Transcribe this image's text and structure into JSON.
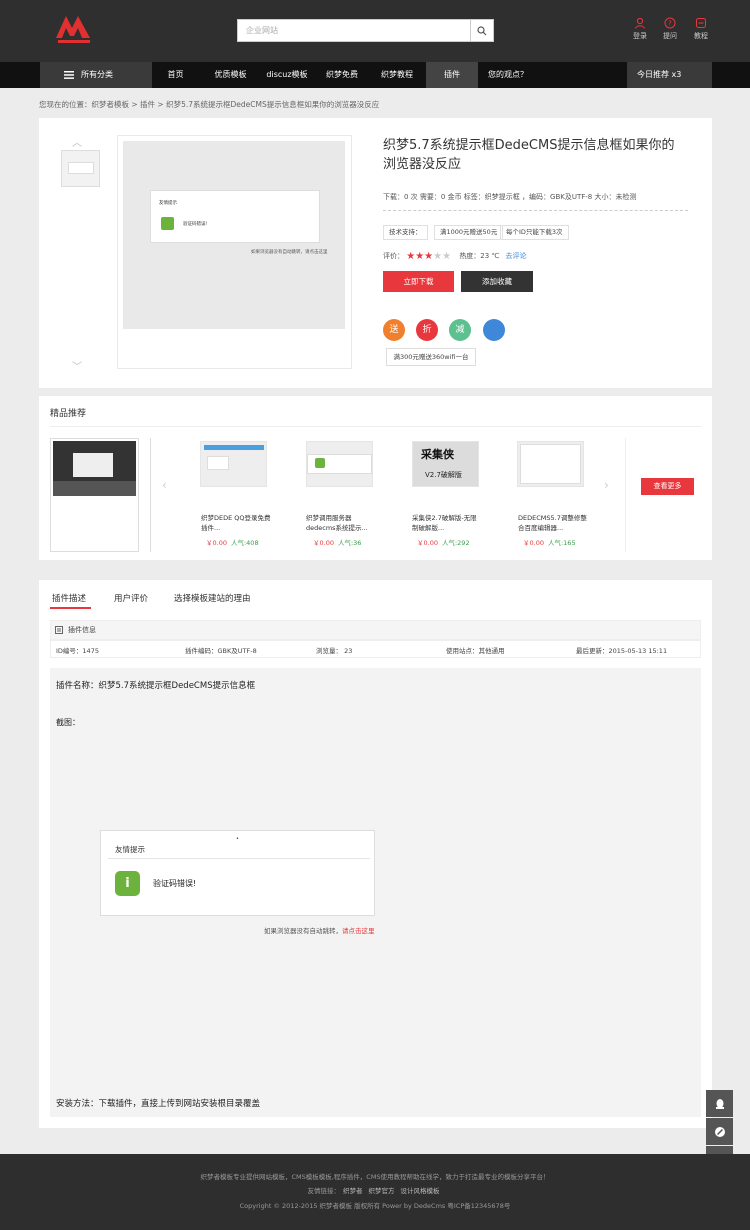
{
  "header": {
    "search_placeholder": "企业网站",
    "icons": [
      {
        "name": "user-icon",
        "label": "登录"
      },
      {
        "name": "help-icon",
        "label": "提问"
      },
      {
        "name": "tutorial-icon",
        "label": "教程"
      }
    ]
  },
  "nav": {
    "category": "所有分类",
    "items": [
      "首页",
      "优质模板",
      "discuz模板",
      "织梦免费",
      "织梦教程",
      "插件",
      "您的观点？"
    ],
    "right": "今日推荐  x3"
  },
  "breadcrumb": "您现在的位置：织梦者模板 > 插件 > 织梦5.7系统提示框DedeCMS提示信息框如果你的浏览器没反应",
  "product": {
    "title": "织梦5.7系统提示框DedeCMS提示信息框如果你的浏览器没反应",
    "meta": "下载：0 次  需要：0 金币  标签：织梦提示框 ，编码：GBK及UTF-8  大小：未检测",
    "tags": [
      "技术支持：",
      "满1000元赠送50元",
      "每个ID只能下载3次"
    ],
    "rating_label": "评价：",
    "heat": "热度：23 ℃",
    "comment_link": "去评论",
    "stars": 3,
    "download_button": "立即下载",
    "favorite_button": "添加收藏",
    "circles": [
      {
        "text": "送",
        "color": "#f0802d"
      },
      {
        "text": "折",
        "color": "#e8383d"
      },
      {
        "text": "减",
        "color": "#5cc08f"
      },
      {
        "text": "",
        "color": "#3f87d9"
      }
    ],
    "promo": "满300元赠送360wifi一台",
    "mock_dialog_title": "友情提示",
    "mock_dialog_msg": "验证码错误!",
    "mock_redirect": "如果浏览器没有自动跳转，请点击这里"
  },
  "recommend": {
    "title": "精品推荐",
    "more_button": "查看更多",
    "items": [
      {
        "name": "织梦DEDE QQ登录免费插件...",
        "price": "￥0.00",
        "pop": "人气:408"
      },
      {
        "name": "织梦调用服务器dedecms系统提示...",
        "price": "￥0.00",
        "pop": "人气:36"
      },
      {
        "name": "采集侠2.7破解版-无限制破解版...",
        "price": "￥0.00",
        "pop": "人气:292",
        "img_title": "采集侠",
        "img_sub": "V2.7破解版"
      },
      {
        "name": "DEDECMS5.7调整修整合百度编辑器...",
        "price": "￥0.00",
        "pop": "人气:165"
      }
    ]
  },
  "tabs": [
    "插件描述",
    "用户评价",
    "选择模板建站的理由"
  ],
  "info": {
    "head": "插件信息",
    "cells": [
      "ID编号：1475",
      "插件编码：GBK及UTF-8",
      "浏览量： 23",
      "使用站点：其他通用",
      "最后更新：2015-05-13 15:11"
    ]
  },
  "content": {
    "plugin_name": "插件名称：织梦5.7系统提示框DedeCMS提示信息框",
    "screenshot_label": "截图：",
    "dialog_title": "友情提示",
    "dialog_msg": "验证码错误!",
    "redirect_text": "如果浏览器没有自动跳转，",
    "redirect_link": "请点击这里",
    "install": "安装方法：下载插件，直接上传到网站安装根目录覆盖"
  },
  "footer": {
    "line1": "织梦者模板专业提供网站模板，CMS模板模板,程序插件，CMS使用教程帮助在线学，致力于打造最专业的模板分享平台！",
    "links_label": "友情链接：",
    "links": [
      "织梦者",
      "织梦官方",
      "设计风格模板"
    ],
    "copyright": "Copyright © 2012-2015 织梦者模板 版权所有 Power by DedeCms  粤ICP备12345678号"
  },
  "colors": {
    "accent": "#e8383d",
    "dark": "#2f2f2f",
    "nav": "#111111"
  }
}
